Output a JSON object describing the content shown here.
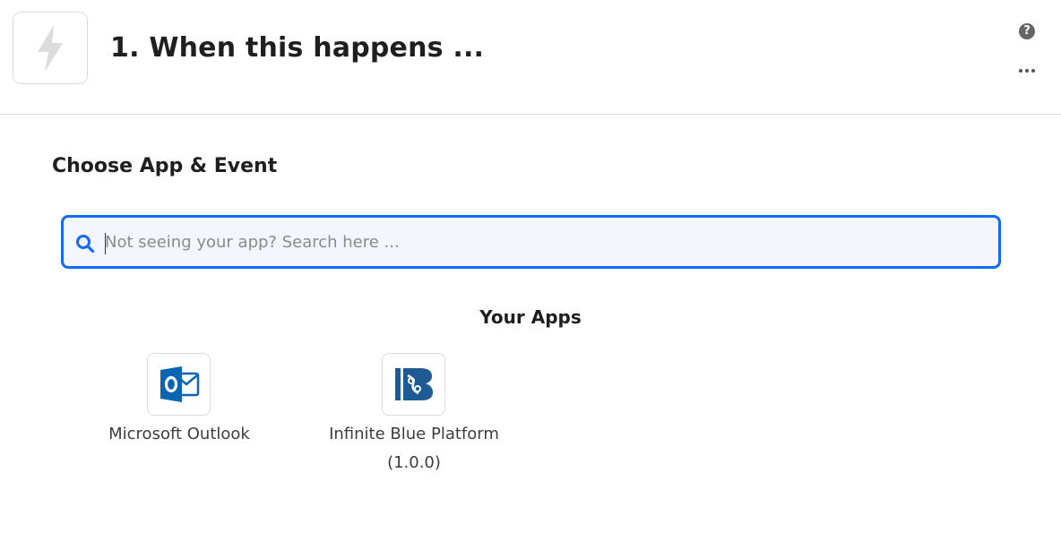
{
  "header": {
    "step_title": "1. When this happens ...",
    "trigger_icon": "lightning-bolt-icon",
    "help_icon": "question-circle-icon",
    "help_glyph": "?",
    "more_icon": "more-horizontal-icon"
  },
  "main": {
    "section_title": "Choose App & Event",
    "search": {
      "placeholder": "Not seeing your app? Search here ...",
      "value": "",
      "icon": "search-icon"
    },
    "your_apps_title": "Your Apps",
    "apps": [
      {
        "name": "Microsoft Outlook",
        "icon": "microsoft-outlook-logo"
      },
      {
        "name": "Infinite Blue Platform",
        "version": "(1.0.0)",
        "icon": "infinite-blue-logo"
      }
    ]
  },
  "colors": {
    "accent": "#136bf5",
    "search_bg": "#f3f7fd",
    "outlook_blue": "#0a64b4",
    "infinite_blue": "#1e5a94"
  }
}
